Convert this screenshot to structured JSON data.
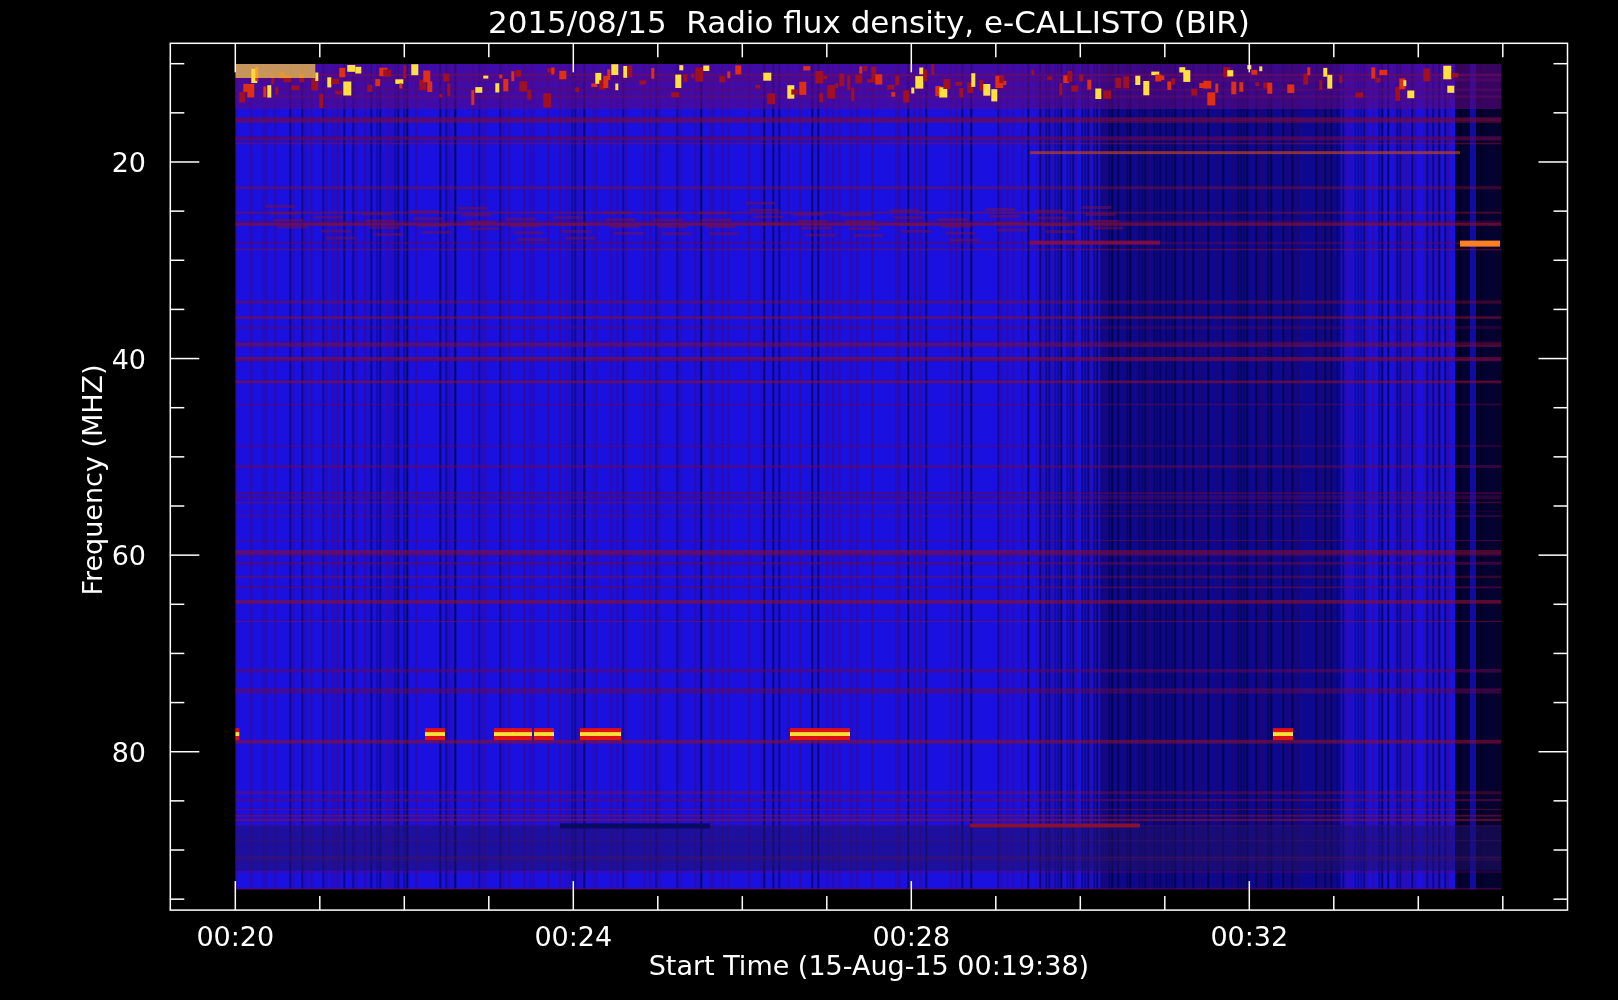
{
  "plot": {
    "title": "2015/08/15  Radio flux density, e-CALLISTO (BIR)",
    "xlabel": "Start Time (15-Aug-15 00:19:38)",
    "ylabel": "Frequency (MHZ)",
    "xticks": [
      "00:20",
      "00:24",
      "00:28",
      "00:32"
    ],
    "yticks": [
      "20",
      "40",
      "60",
      "80"
    ]
  }
}
